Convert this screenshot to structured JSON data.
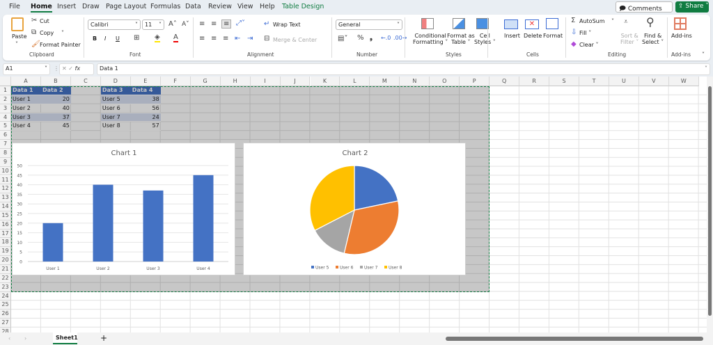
{
  "ribbon_tabs": [
    "File",
    "Home",
    "Insert",
    "Draw",
    "Page Layout",
    "Formulas",
    "Data",
    "Review",
    "View",
    "Help",
    "Table Design"
  ],
  "top_buttons": {
    "comments": "Comments",
    "share": "Share"
  },
  "clipboard": {
    "paste": "Paste",
    "cut": "Cut",
    "copy": "Copy",
    "format_painter": "Format Painter",
    "label": "Clipboard"
  },
  "font": {
    "name": "Calibri",
    "size": "11",
    "bold": "B",
    "italic": "I",
    "underline": "U",
    "label": "Font"
  },
  "alignment": {
    "wrap_text": "Wrap Text",
    "merge_center": "Merge & Center",
    "label": "Alignment"
  },
  "number": {
    "format": "General",
    "label": "Number"
  },
  "styles": {
    "conditional": [
      "Conditional",
      "Formatting ˅"
    ],
    "format_table": [
      "Format as",
      "Table ˅"
    ],
    "cell_styles": [
      "Cell",
      "Styles ˅"
    ],
    "label": "Styles"
  },
  "cells": {
    "insert": "Insert",
    "delete": "Delete",
    "format": "Format",
    "label": "Cells"
  },
  "editing": {
    "autosum": "AutoSum",
    "fill": "Fill ˅",
    "clear": "Clear ˅",
    "sort_filter": [
      "Sort &",
      "Filter ˅"
    ],
    "find_select": [
      "Find &",
      "Select ˅"
    ],
    "label": "Editing"
  },
  "addins": {
    "button": "Add-ins",
    "label": "Add-ins"
  },
  "formula_bar": {
    "name_box": "A1",
    "fx": "fx",
    "formula": "Data 1"
  },
  "columns": [
    "A",
    "B",
    "C",
    "D",
    "E",
    "F",
    "G",
    "H",
    "I",
    "J",
    "K",
    "L",
    "M",
    "N",
    "O",
    "P",
    "Q",
    "R",
    "S",
    "T",
    "U",
    "V",
    "W"
  ],
  "rows": [
    "1",
    "2",
    "3",
    "4",
    "5",
    "6",
    "7",
    "8",
    "9",
    "10",
    "11",
    "12",
    "13",
    "14",
    "15",
    "16",
    "17",
    "18",
    "19",
    "20",
    "21",
    "22",
    "23",
    "24",
    "25",
    "26",
    "27",
    "28"
  ],
  "table1": {
    "headers": [
      "Data 1",
      "Data 2"
    ],
    "rows": [
      [
        "User 1",
        "20"
      ],
      [
        "User 2",
        "40"
      ],
      [
        "User 3",
        "37"
      ],
      [
        "User 4",
        "45"
      ]
    ]
  },
  "table2": {
    "headers": [
      "Data 3",
      "Data 4"
    ],
    "rows": [
      [
        "User 5",
        "38"
      ],
      [
        "User 6",
        "56"
      ],
      [
        "User 7",
        "24"
      ],
      [
        "User 8",
        "57"
      ]
    ]
  },
  "sheet_tabs": {
    "active": "Sheet1",
    "add": "+"
  },
  "chart_data": [
    {
      "type": "bar",
      "title": "Chart 1",
      "categories": [
        "User 1",
        "User 2",
        "User 3",
        "User 4"
      ],
      "values": [
        20,
        40,
        37,
        45
      ],
      "ylim": [
        0,
        50
      ],
      "yticks": [
        "0",
        "5",
        "10",
        "15",
        "20",
        "25",
        "30",
        "35",
        "40",
        "45",
        "50"
      ],
      "grid": true,
      "color": "#4472c4",
      "xlabel": "",
      "ylabel": ""
    },
    {
      "type": "pie",
      "title": "Chart 2",
      "categories": [
        "User 5",
        "User 6",
        "User 7",
        "User 8"
      ],
      "values": [
        38,
        56,
        24,
        57
      ],
      "colors": [
        "#4472c4",
        "#ed7d31",
        "#a5a5a5",
        "#ffc000"
      ],
      "legend": "bottom"
    }
  ]
}
